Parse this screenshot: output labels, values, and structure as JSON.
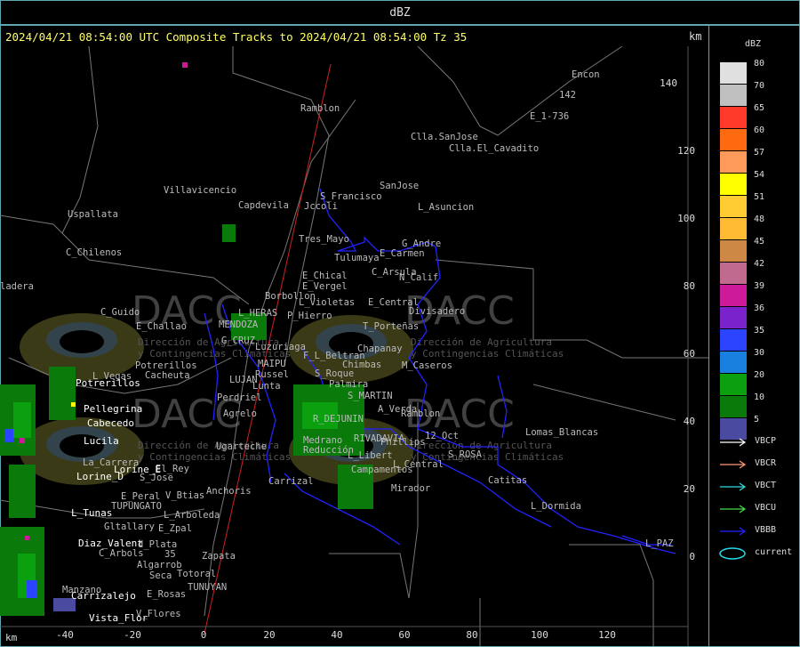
{
  "window_title": "dBZ",
  "subtitle": "2024/04/21 08:54:00 UTC Composite Tracks to 2024/04/21 08:54:00 Tz 35",
  "axes": {
    "unit": "km",
    "x_ticks": [
      "-40",
      "-20",
      "0",
      "20",
      "40",
      "60",
      "80",
      "100",
      "120"
    ],
    "y_ticks": [
      "140",
      "120",
      "100",
      "80",
      "60",
      "40",
      "20",
      "0"
    ]
  },
  "legend": {
    "title": "dBZ",
    "levels": [
      {
        "label": "80",
        "color": "#e0e0e0"
      },
      {
        "label": "70",
        "color": "#c0c0c0"
      },
      {
        "label": "65",
        "color": "#ff3a2a"
      },
      {
        "label": "60",
        "color": "#ff6a10"
      },
      {
        "label": "57",
        "color": "#ff9a5a"
      },
      {
        "label": "54",
        "color": "#ffff00"
      },
      {
        "label": "51",
        "color": "#ffcc33"
      },
      {
        "label": "48",
        "color": "#ffbb33"
      },
      {
        "label": "45",
        "color": "#cc8844"
      },
      {
        "label": "42",
        "color": "#c06a90"
      },
      {
        "label": "39",
        "color": "#cc1a9a"
      },
      {
        "label": "36",
        "color": "#7a22cc"
      },
      {
        "label": "35",
        "color": "#2a44ff"
      },
      {
        "label": "30",
        "color": "#1a80e0"
      },
      {
        "label": "20",
        "color": "#0aa010"
      },
      {
        "label": "10",
        "color": "#0a7a0a"
      },
      {
        "label": "5",
        "color": "#4a4aa0"
      }
    ],
    "tracks": [
      {
        "label": "VBCP",
        "color": "#ffffff"
      },
      {
        "label": "VBCR",
        "color": "#ff9977"
      },
      {
        "label": "VBCT",
        "color": "#33dddd"
      },
      {
        "label": "VBCU",
        "color": "#44dd44"
      },
      {
        "label": "VBBB",
        "color": "#2222ff"
      },
      {
        "label": "current",
        "color": "#22ddee"
      }
    ]
  },
  "watermark": {
    "name": "DACC",
    "line1": "Dirección de Agricultura",
    "line2": "y Contingencias Climáticas"
  },
  "places_gray": [
    "Ramblon",
    "Encon",
    "142",
    "E_1-736",
    "Clla.SanJose",
    "Clla.El_Cavadito",
    "SanJose",
    "S_Francisco",
    "Jccoli",
    "L_Asuncion",
    "Villavicencio",
    "Capdevila",
    "Uspallata",
    "C_Chilenos",
    "Tres_Mayo",
    "Tulumaya",
    "G_Andre",
    "E_Carmen",
    "C_Arsula",
    "N_Calif",
    "E_Chical",
    "E_Vergel",
    "Borbollon",
    "L_Violetas",
    "E_Central",
    "Divisadero",
    "C_Guido",
    "L_HERAS",
    "P_Hierro",
    "T_Porteñas",
    "MENDOZA",
    "E_Challao",
    "G_CRUZ",
    "Luzuriaga",
    "Chapanay",
    "F_L_Beltran",
    "Chimbas",
    "M_Caseros",
    "Potrerillos",
    "Cacheuta",
    "MAIPU",
    "Russel",
    "S_Roque",
    "L_Vegas",
    "LUJAN",
    "Lunta",
    "Palmira",
    "S_MARTIN",
    "Perdriel",
    "Agrelo",
    "A_Verda",
    "Ramblon",
    "R_DEJUNIN",
    "Medrano",
    "RIVADAVIA",
    "Phillips",
    "12_Oct",
    "Lomas_Blancas",
    "Ugarteche",
    "Reducción",
    "L_Libert",
    "S_ROSA",
    "La_Carrera",
    "El_Rey",
    "S_Jose",
    "L_Central",
    "Campamentos",
    "Carrizal",
    "Catitas",
    "E_Peral",
    "V_Btias",
    "Anchoris",
    "Mirador",
    "TUPUNGATO",
    "L_Arboleda",
    "L_Dormida",
    "Gltallary",
    "E_Zpal",
    "d_Plata",
    "C_Arbols",
    "35",
    "Zapata",
    "L_PAZ",
    "Algarrob",
    "Seca",
    "Totoral",
    "TUNUYAN",
    "E_Rosas",
    "V_Flores",
    "Manzano",
    "ladera"
  ],
  "places_white": [
    "Potrerillos",
    "Pellegrina",
    "Cabecedo",
    "Lucila",
    "Lorine_E",
    "Lorine_D",
    "L_Tunas",
    "Diaz_Valent",
    "Carrizalejo",
    "Vista_Flor"
  ]
}
